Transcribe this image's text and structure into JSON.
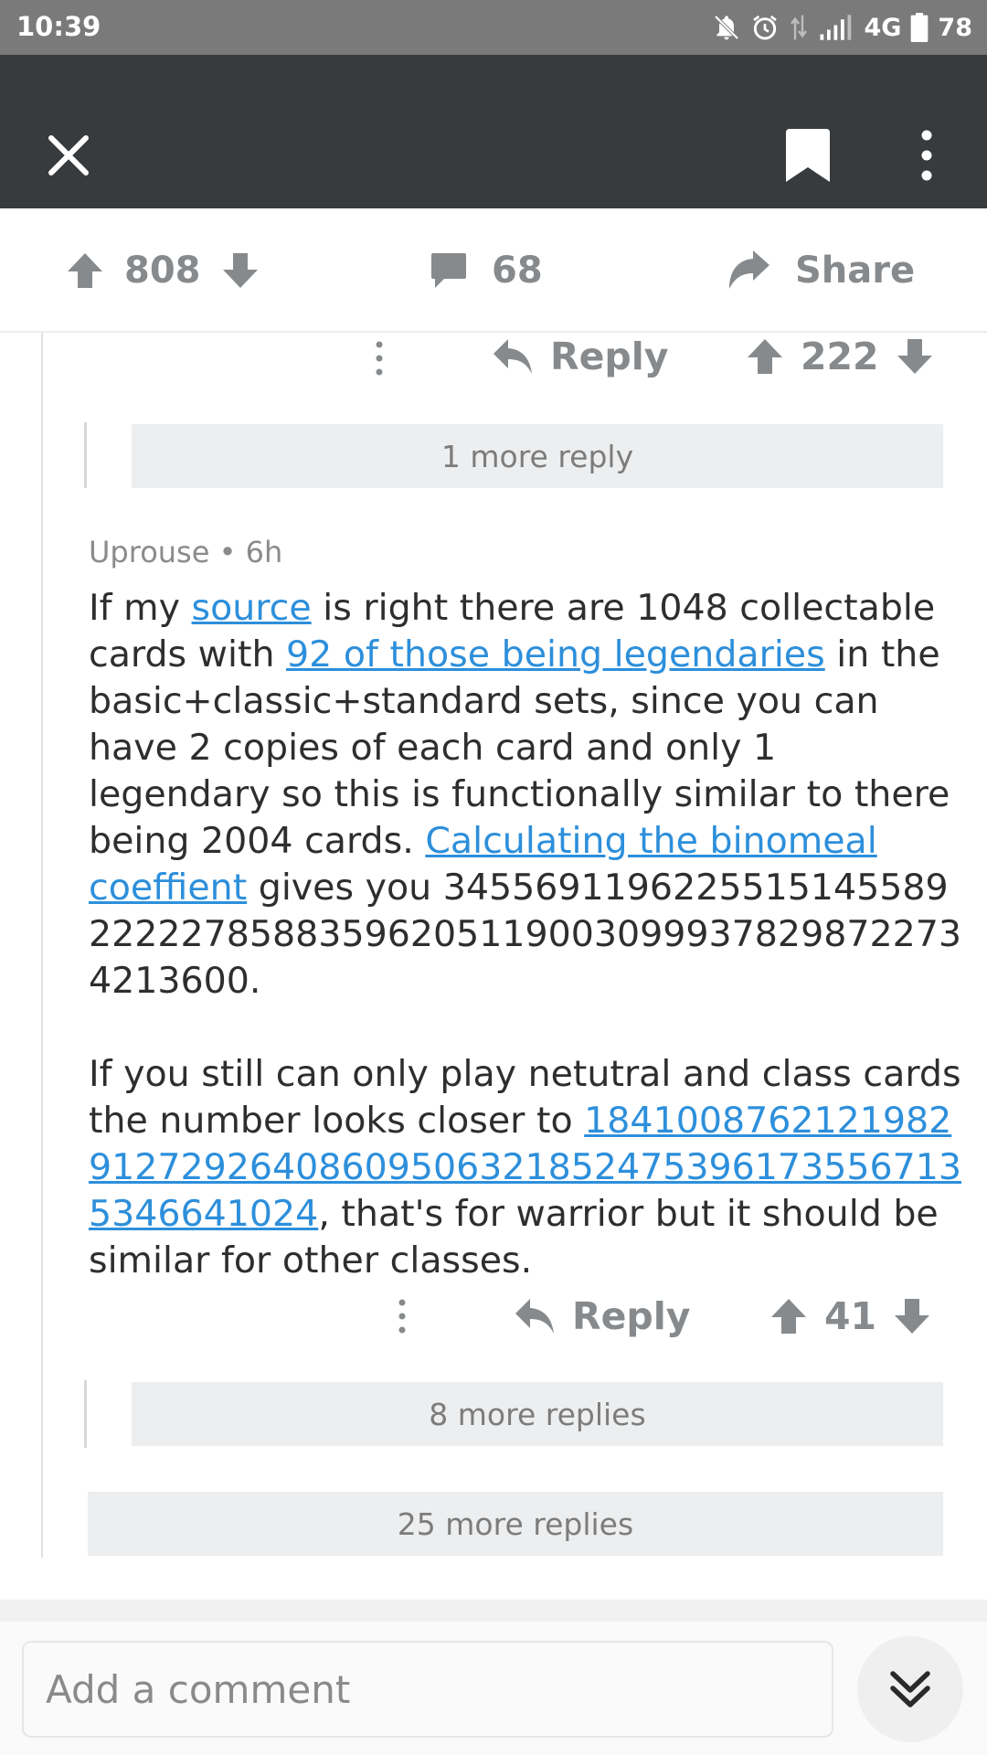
{
  "status_bar": {
    "time": "10:39",
    "network": "4G",
    "battery": "78"
  },
  "action_bar": {
    "score": "808",
    "comment_count": "68",
    "share_label": "Share"
  },
  "parent_comment": {
    "reply_label": "Reply",
    "score": "222",
    "more_replies": "1 more reply"
  },
  "comment": {
    "author": "Uprouse",
    "separator": "•",
    "age": "6h",
    "paragraph1": {
      "t1": "If my ",
      "link1": "source",
      "t2": " is right there are 1048 collectable cards with ",
      "link2": "92 of those being legendaries",
      "t3": " in the basic+classic+standard sets, since you can have 2 copies of each card and only 1 legendary so this is functionally similar to there being 2004 cards. ",
      "link3": "Calculating the binomeal coeffient",
      "t4": " gives you 3455691196225515145589222227858835962051190030999378298722734213600."
    },
    "paragraph2": {
      "t1": "If you still can only play netutral and class cards the number looks closer to ",
      "link1": "18410087621219829127292640860950632185247539617355671353466410​24",
      "t2": ", that's for  warrior but it should  be similar for other classes."
    },
    "reply_label": "Reply",
    "score": "41",
    "more_replies": "8 more replies"
  },
  "thread_more_replies": "25 more replies",
  "bottom_bar": {
    "comment_placeholder": "Add a comment"
  },
  "colors": {
    "toolbar": "#373b3e",
    "status_bar": "#7a7a7a",
    "link": "#2d8fdb",
    "icon_gray": "#878a8c"
  }
}
